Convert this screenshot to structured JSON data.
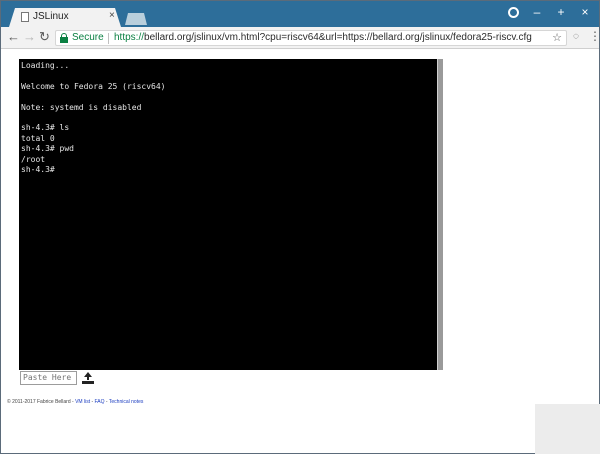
{
  "browser": {
    "tab_title": "JSLinux",
    "tab_close": "×",
    "window_controls": {
      "minimize": "–",
      "maximize": "+",
      "close": "×"
    },
    "nav": {
      "back": "←",
      "forward": "→",
      "reload": "↻"
    },
    "address": {
      "security_label": "Secure",
      "url_scheme": "https://",
      "url_rest": "bellard.org/jslinux/vm.html?cpu=riscv64&url=https://bellard.org/jslinux/fedora25-riscv.cfg"
    },
    "star": "☆",
    "menu": "⋮"
  },
  "terminal": {
    "lines": [
      "Loading...",
      "",
      "Welcome to Fedora 25 (riscv64)",
      "",
      "Note: systemd is disabled",
      "",
      "sh-4.3# ls",
      "total 0",
      "sh-4.3# pwd",
      "/root",
      "sh-4.3#"
    ]
  },
  "paste": {
    "placeholder": "Paste Here"
  },
  "footer": {
    "copyright": "© 2011-2017 Fabrice Bellard - ",
    "links": [
      "VM list",
      "FAQ",
      "Technical notes"
    ],
    "separator": " - "
  },
  "colors": {
    "titlebar": "#2d6e9a",
    "secure_green": "#0b8043",
    "terminal_bg": "#000000",
    "terminal_fg": "#e6e6e6"
  }
}
